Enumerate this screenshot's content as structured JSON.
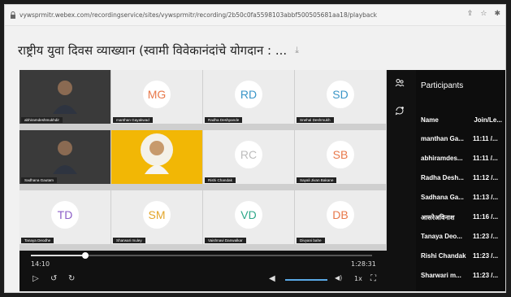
{
  "browser": {
    "url": "vywsprmitr.webex.com/recordingservice/sites/vywsprmitr/recording/2b50c0fa5598103abbf500505681aa18/playback",
    "actions": [
      "share-icon",
      "star-icon",
      "extension-icon"
    ]
  },
  "page": {
    "title": "राष्ट्रीय युवा दिवस व्याख्यान (स्वामी विवेकानंदांचे योगदान : ...",
    "download_icon": "⤓"
  },
  "player": {
    "tiles": [
      {
        "name": "abhiramdeshmukhdir",
        "initials": "",
        "style": "dark",
        "color": ""
      },
      {
        "name": "manthan Gayakwad",
        "initials": "MG",
        "style": "light",
        "color": "#e8784a"
      },
      {
        "name": "Radha Deshpande",
        "initials": "RD",
        "style": "light",
        "color": "#3a96c8"
      },
      {
        "name": "Snehal Deshmukh",
        "initials": "SD",
        "style": "light",
        "color": "#3a96c8"
      },
      {
        "name": "Sadhana Gautam",
        "initials": "",
        "style": "dark",
        "color": ""
      },
      {
        "name": "",
        "initials": "",
        "style": "yellow",
        "color": ""
      },
      {
        "name": "Rishi Chandak",
        "initials": "RC",
        "style": "light",
        "color": "#bdbdbd"
      },
      {
        "name": "Sayali Jivan Bakane",
        "initials": "SB",
        "style": "light",
        "color": "#e8784a"
      },
      {
        "name": "Tanaya Deodhe",
        "initials": "TD",
        "style": "light",
        "color": "#8c5fc7"
      },
      {
        "name": "Sharwari muley",
        "initials": "SM",
        "style": "light",
        "color": "#e3a62b"
      },
      {
        "name": "Vaishnavi Danwalkar",
        "initials": "VD",
        "style": "light",
        "color": "#2fa88a"
      },
      {
        "name": "Divyani bahe",
        "initials": "DB",
        "style": "light",
        "color": "#e8784a"
      }
    ],
    "progress": 0.16,
    "current_time": "14:10",
    "total_time": "1:28:31",
    "controls": {
      "play": "▷",
      "rewind": "↺",
      "forward": "↻",
      "volume": "◀",
      "volume_high": "◀)",
      "speed": "1x",
      "fullscreen": "⛶"
    },
    "volume_level": 0.8
  },
  "sidebar_icons": [
    "participants-icon",
    "chat-icon"
  ],
  "participants": {
    "title": "Participants",
    "col_name": "Name",
    "col_time": "Join/Le...",
    "rows": [
      {
        "name": "manthan Ga...",
        "time": "11:11 /..."
      },
      {
        "name": "abhiramdes...",
        "time": "11:11 /..."
      },
      {
        "name": "Radha Desh...",
        "time": "11:12 /..."
      },
      {
        "name": "Sadhana Ga...",
        "time": "11:13 /..."
      },
      {
        "name": "आसरेअविनाश",
        "time": "11:16 /..."
      },
      {
        "name": "Tanaya Deo...",
        "time": "11:23 /..."
      },
      {
        "name": "Rishi Chandak",
        "time": "11:23 /..."
      },
      {
        "name": "Sharwari m...",
        "time": "11:23 /..."
      }
    ]
  }
}
